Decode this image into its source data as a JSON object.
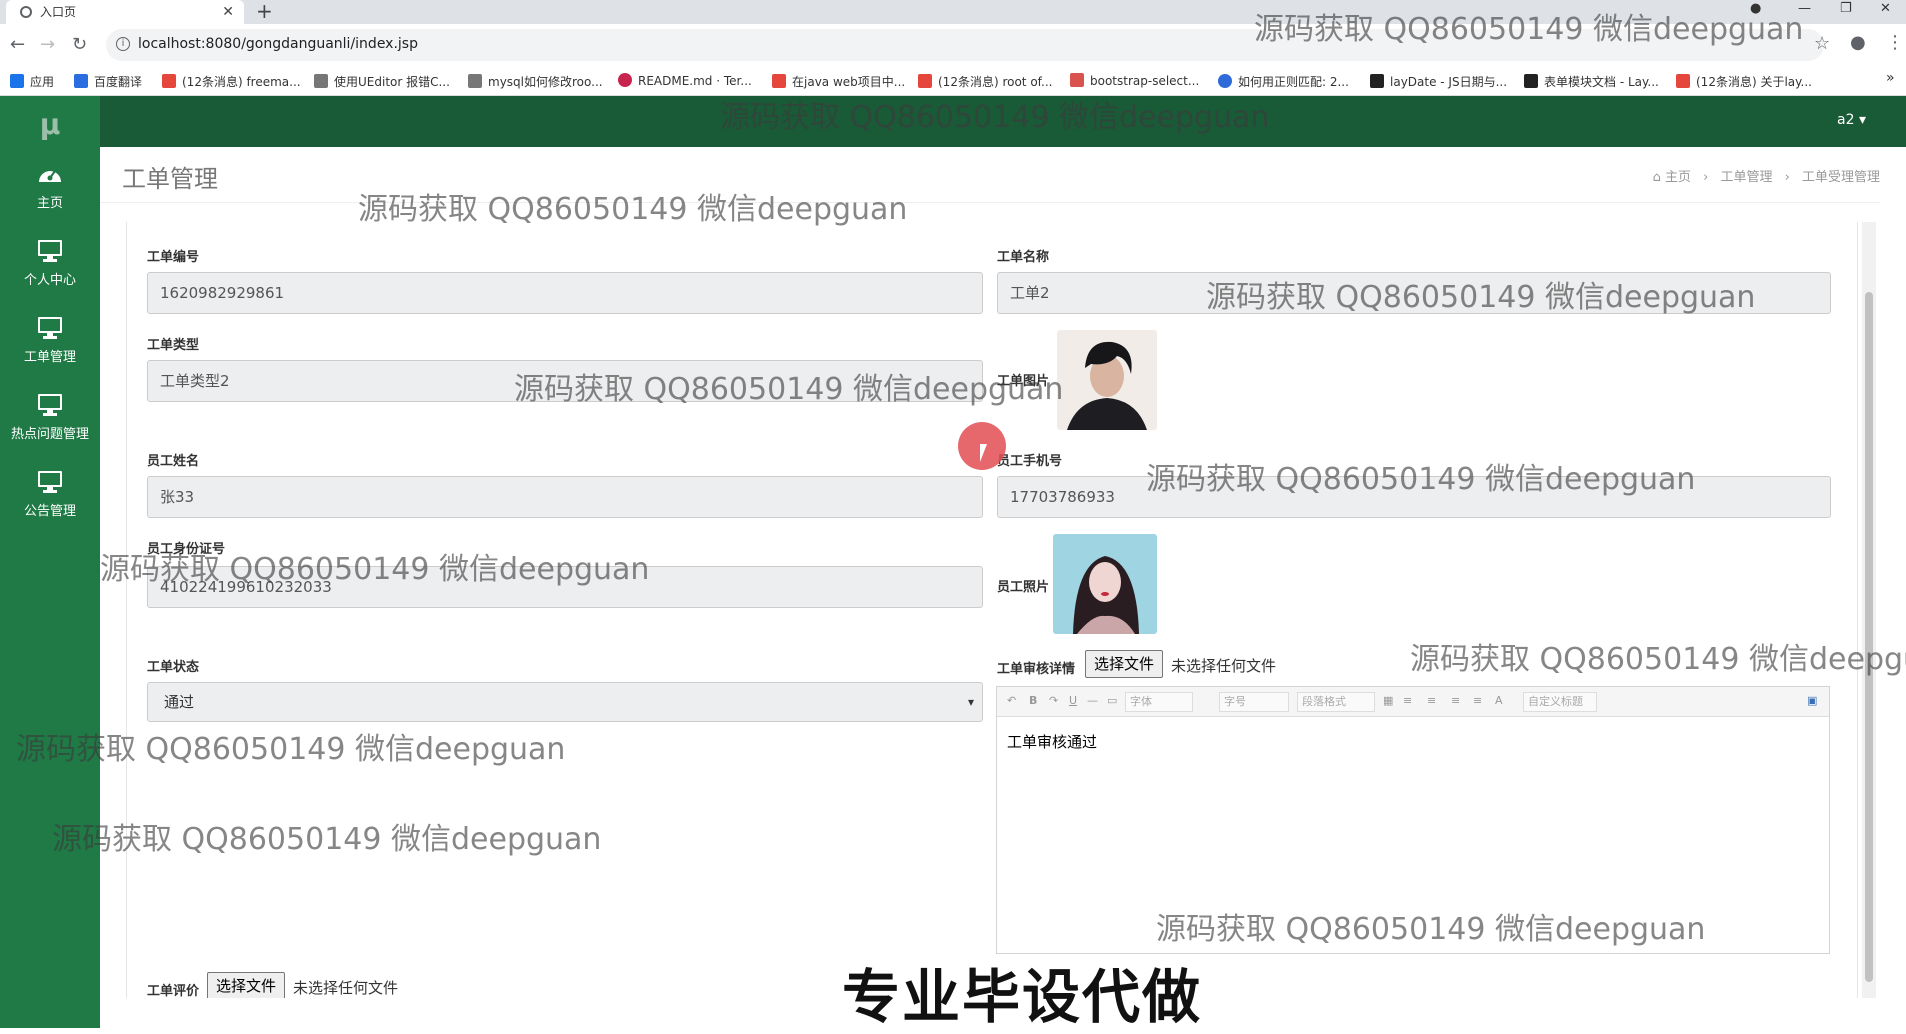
{
  "browser": {
    "tab_title": "入口页",
    "url": "localhost:8080/gongdanguanli/index.jsp",
    "bookmarks": [
      {
        "label": "应用",
        "color": "#1a73e8"
      },
      {
        "label": "百度翻译",
        "color": "#2b6de0"
      },
      {
        "label": "(12条消息) freema...",
        "color": "#e5473c"
      },
      {
        "label": "使用UEditor 报错C...",
        "color": "#444"
      },
      {
        "label": "mysql如何修改roo...",
        "color": "#444"
      },
      {
        "label": "README.md · Ter...",
        "color": "#c7254e"
      },
      {
        "label": "在java web项目中...",
        "color": "#e5473c"
      },
      {
        "label": "(12条消息) root of...",
        "color": "#e5473c"
      },
      {
        "label": "bootstrap-select...",
        "color": "#d9534f"
      },
      {
        "label": "如何用正则匹配: 2...",
        "color": "#2e6bd8"
      },
      {
        "label": "layDate - JS日期与...",
        "color": "#222"
      },
      {
        "label": "表单模块文档 - Lay...",
        "color": "#222"
      },
      {
        "label": "(12条消息) 关于lay...",
        "color": "#e5473c"
      }
    ]
  },
  "app": {
    "logo": "μ",
    "user": "a2 ▾",
    "sidebar": [
      {
        "label": "主页",
        "icon": "dashboard-icon"
      },
      {
        "label": "个人中心",
        "icon": "monitor-icon"
      },
      {
        "label": "工单管理",
        "icon": "monitor-icon"
      },
      {
        "label": "热点问题管理",
        "icon": "monitor-icon"
      },
      {
        "label": "公告管理",
        "icon": "monitor-icon"
      }
    ],
    "page_title": "工单管理",
    "breadcrumb": [
      "主页",
      "工单管理",
      "工单受理管理"
    ]
  },
  "form": {
    "ticket_no": {
      "label": "工单编号",
      "value": "1620982929861"
    },
    "ticket_name": {
      "label": "工单名称",
      "value": "工单2"
    },
    "ticket_type": {
      "label": "工单类型",
      "value": "工单类型2"
    },
    "ticket_image": {
      "label": "工单图片"
    },
    "employee_name": {
      "label": "员工姓名",
      "value": "张33"
    },
    "employee_phone": {
      "label": "员工手机号",
      "value": "17703786933"
    },
    "employee_id": {
      "label": "员工身份证号",
      "value": "410224199610232033"
    },
    "employee_photo": {
      "label": "员工照片"
    },
    "ticket_status": {
      "label": "工单状态",
      "value": "通过"
    },
    "review_detail": {
      "label": "工单审核详情",
      "file_button": "选择文件",
      "file_text": "未选择任何文件",
      "content": "工单审核通过"
    },
    "evaluation": {
      "label": "工单评价",
      "file_button": "选择文件",
      "file_text": "未选择任何文件"
    }
  },
  "editor_toolbar": {
    "font": "字体",
    "size": "字号",
    "paragraph": "段落格式",
    "custom": "自定义标题"
  },
  "watermark": "源码获取 QQ86050149 微信deepguan",
  "watermark_cut": "源码获取 QQ86050149 微信deepgu",
  "banner": "专业毕设代做"
}
